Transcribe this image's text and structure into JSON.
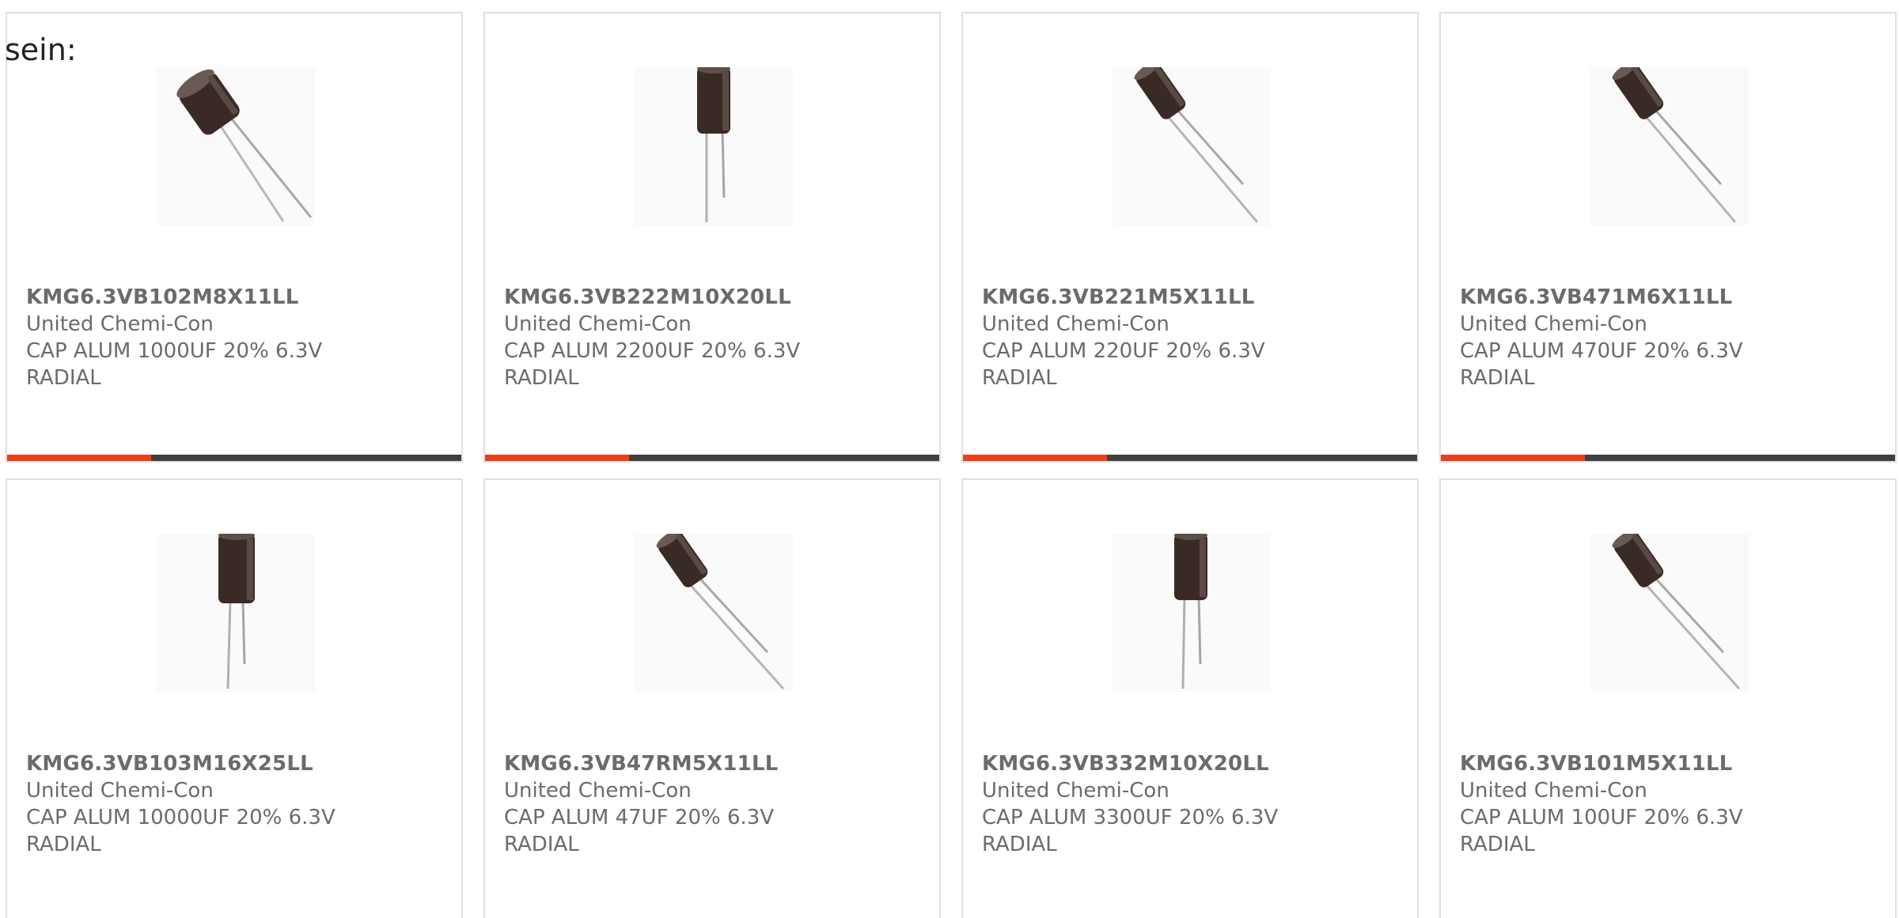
{
  "intro_text": "sein:",
  "accent_color": "#e8401c",
  "bar_color": "#3f3f3f",
  "products": [
    {
      "part_number": "KMG6.3VB102M8X11LL",
      "manufacturer": "United Chemi-Con",
      "desc_line1": "CAP ALUM 1000UF 20% 6.3V",
      "desc_line2": "RADIAL",
      "image_icon": "capacitor-tilted-icon"
    },
    {
      "part_number": "KMG6.3VB222M10X20LL",
      "manufacturer": "United Chemi-Con",
      "desc_line1": "CAP ALUM 2200UF 20% 6.3V",
      "desc_line2": "RADIAL",
      "image_icon": "capacitor-upright-icon"
    },
    {
      "part_number": "KMG6.3VB221M5X11LL",
      "manufacturer": "United Chemi-Con",
      "desc_line1": "CAP ALUM 220UF 20% 6.3V",
      "desc_line2": "RADIAL",
      "image_icon": "capacitor-tilted-icon"
    },
    {
      "part_number": "KMG6.3VB471M6X11LL",
      "manufacturer": "United Chemi-Con",
      "desc_line1": "CAP ALUM 470UF 20% 6.3V",
      "desc_line2": "RADIAL",
      "image_icon": "capacitor-tilted-icon"
    },
    {
      "part_number": "KMG6.3VB103M16X25LL",
      "manufacturer": "United Chemi-Con",
      "desc_line1": "CAP ALUM 10000UF 20% 6.3V",
      "desc_line2": "RADIAL",
      "image_icon": "capacitor-upright-icon"
    },
    {
      "part_number": "KMG6.3VB47RM5X11LL",
      "manufacturer": "United Chemi-Con",
      "desc_line1": "CAP ALUM 47UF 20% 6.3V",
      "desc_line2": "RADIAL",
      "image_icon": "capacitor-tilted-icon"
    },
    {
      "part_number": "KMG6.3VB332M10X20LL",
      "manufacturer": "United Chemi-Con",
      "desc_line1": "CAP ALUM 3300UF 20% 6.3V",
      "desc_line2": "RADIAL",
      "image_icon": "capacitor-upright-icon"
    },
    {
      "part_number": "KMG6.3VB101M5X11LL",
      "manufacturer": "United Chemi-Con",
      "desc_line1": "CAP ALUM 100UF 20% 6.3V",
      "desc_line2": "RADIAL",
      "image_icon": "capacitor-tilted-icon"
    }
  ]
}
